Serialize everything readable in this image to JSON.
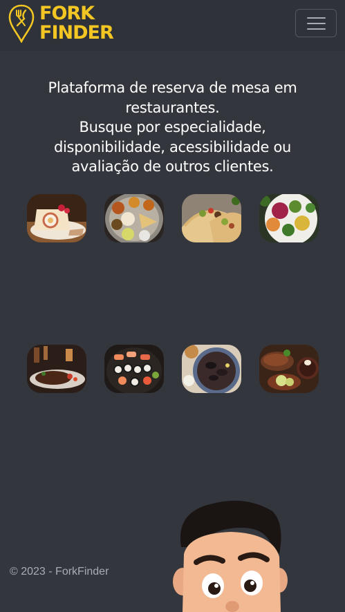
{
  "brand": {
    "line1": "FORK",
    "line2": "FINDER",
    "logo_icon": "map-pin-fork-knife-icon",
    "color": "#f3c623"
  },
  "navbar": {
    "menu_icon": "hamburger-icon"
  },
  "hero": {
    "line1": "Plataforma de reserva de mesa em",
    "line2": "restaurantes.",
    "line3": "Busque por especialidade,",
    "line4": "disponibilidade, acessibilidade ou",
    "line5": "avaliação de outros clientes."
  },
  "categories": [
    {
      "image": "cake-slice-dessert"
    },
    {
      "image": "indian-thali-platter"
    },
    {
      "image": "tacos"
    },
    {
      "image": "vegetarian-plate"
    },
    {
      "image": "grilled-steak"
    },
    {
      "image": "sushi-platter"
    },
    {
      "image": "seafood-dish"
    },
    {
      "image": "feijoada-meal"
    }
  ],
  "footer": {
    "copyright": "© 2023 - ForkFinder"
  },
  "mascot": {
    "image": "cartoon-boy-character"
  },
  "colors": {
    "background": "#33363d",
    "navbar": "#2f3238",
    "text": "#ffffff",
    "muted": "#a9adb3"
  }
}
